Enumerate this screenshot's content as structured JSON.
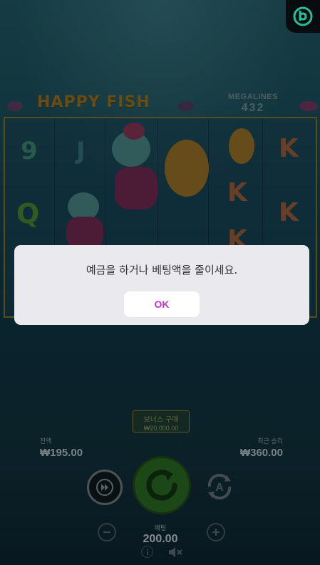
{
  "game": {
    "title": "HAPPY FISH",
    "megalines_label": "MEGALINES",
    "megalines_value": "432"
  },
  "reels": {
    "symbols": [
      "9",
      "J",
      "Q",
      "K",
      "K",
      "K",
      "K"
    ]
  },
  "dialog": {
    "message": "예금을 하거나 베팅액을 줄이세요.",
    "ok_label": "OK"
  },
  "bonus": {
    "label": "보너스 구매",
    "price": "₩20,000.00"
  },
  "balance": {
    "label": "잔액",
    "value": "₩195.00"
  },
  "last_win": {
    "label": "최근 승리",
    "value": "₩360.00"
  },
  "bet": {
    "label": "배팅",
    "value": "200.00"
  },
  "icons": {
    "brand": "brand-logo-icon",
    "spin": "spin-icon",
    "turbo": "fast-forward-icon",
    "autoplay": "autoplay-icon",
    "minus": "minus-icon",
    "plus": "plus-icon",
    "info": "info-icon",
    "mute": "mute-icon"
  },
  "colors": {
    "dialog_bg": "#e9e9ee",
    "ok_text": "#c037c8",
    "brand_accent": "#2fe0b5",
    "spin_green": "#2d6a1f"
  }
}
